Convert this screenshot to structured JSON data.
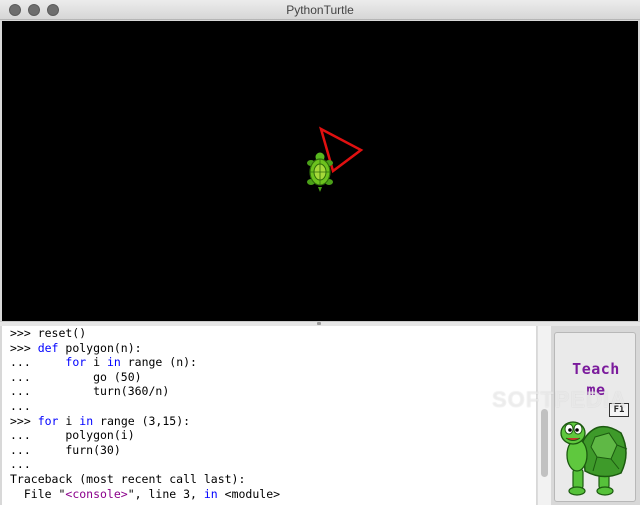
{
  "window": {
    "title": "PythonTurtle"
  },
  "canvas": {
    "background": "#000000",
    "triangle_color": "#e01010",
    "turtle_icon": "turtle-icon"
  },
  "shell": {
    "lines": [
      ">>> reset()",
      ">>> def polygon(n):",
      "...     for i in range (n):",
      "...         go (50)",
      "...         turn(360/n)",
      "...",
      ">>> for i in range (3,15):",
      "...     polygon(i)",
      "...     furn(30)",
      "...",
      "Traceback (most recent call last):",
      "  File \"<console>\", line 3, in <module>"
    ]
  },
  "help": {
    "teach_line1": "Teach",
    "teach_line2": "me",
    "key": "F1",
    "accent": "#7b1b9c"
  },
  "watermark": "SOFTPEDIA"
}
